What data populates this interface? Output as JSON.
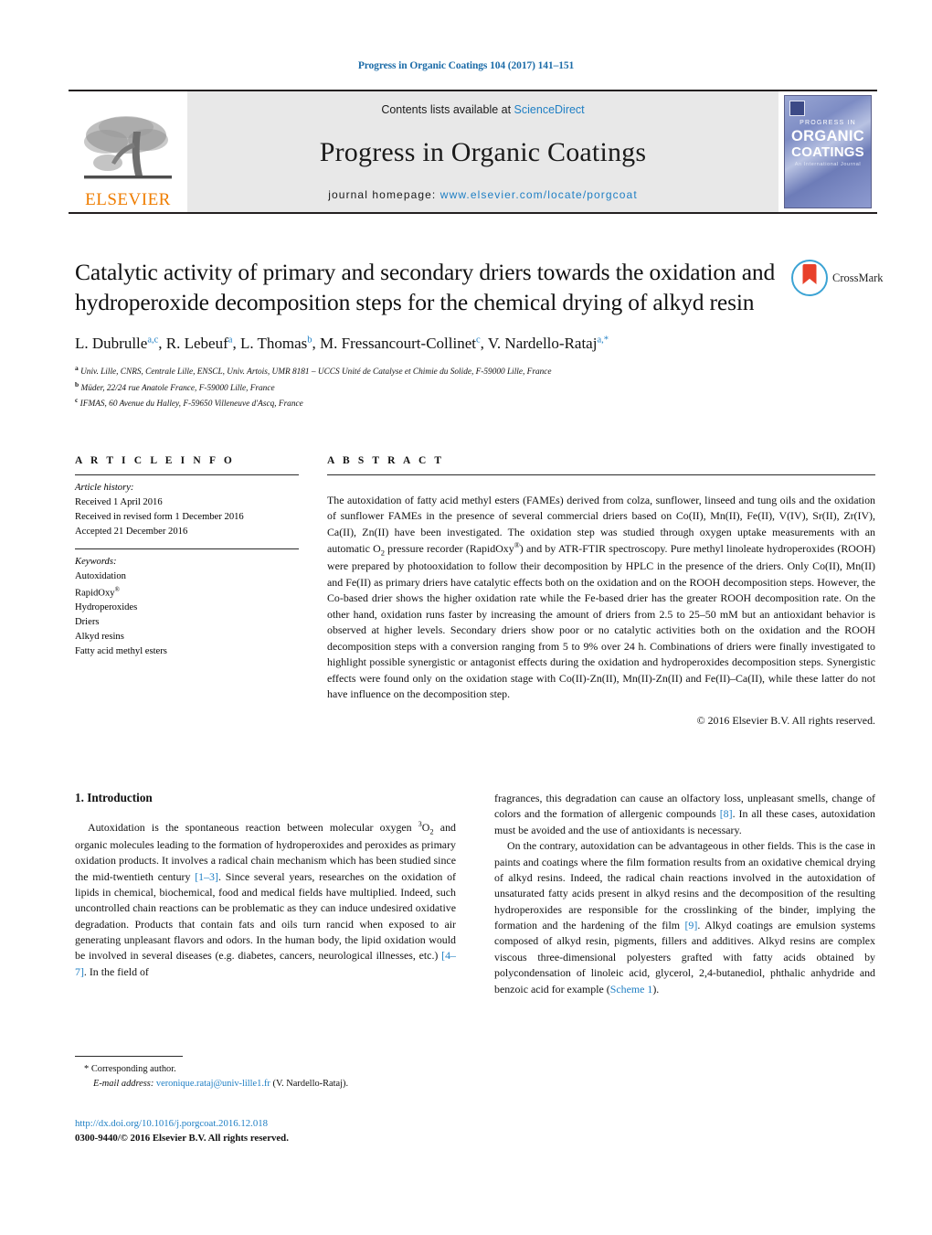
{
  "running_head": "Progress in Organic Coatings 104 (2017) 141–151",
  "masthead": {
    "publisher_name": "ELSEVIER",
    "contents_prefix": "Contents lists available at ",
    "contents_link": "ScienceDirect",
    "journal_title": "Progress in Organic Coatings",
    "homepage_prefix": "journal homepage: ",
    "homepage_url": "www.elsevier.com/locate/porgcoat",
    "cover": {
      "line1": "PROGRESS IN",
      "line2": "ORGANIC",
      "line3": "COATINGS",
      "line4": "An International Journal"
    }
  },
  "article": {
    "title": "Catalytic activity of primary and secondary driers towards the oxidation and hydroperoxide decomposition steps for the chemical drying of alkyd resin",
    "crossmark_label": "CrossMark",
    "authors": [
      {
        "name": "L. Dubrulle",
        "marks": "a,c"
      },
      {
        "name": "R. Lebeuf",
        "marks": "a"
      },
      {
        "name": "L. Thomas",
        "marks": "b"
      },
      {
        "name": "M. Fressancourt-Collinet",
        "marks": "c"
      },
      {
        "name": "V. Nardello-Rataj",
        "marks": "a,*"
      }
    ],
    "affiliations": [
      {
        "mark": "a",
        "text": "Univ. Lille, CNRS, Centrale Lille, ENSCL, Univ. Artois, UMR 8181 – UCCS Unité de Catalyse et Chimie du Solide, F-59000 Lille, France"
      },
      {
        "mark": "b",
        "text": "Müder, 22/24 rue Anatole France, F-59000 Lille, France"
      },
      {
        "mark": "c",
        "text": "IFMAS, 60 Avenue du Halley, F-59650 Villeneuve d'Ascq, France"
      }
    ]
  },
  "article_info": {
    "heading": "A R T I C L E   I N F O",
    "history_label": "Article history:",
    "history": [
      "Received 1 April 2016",
      "Received in revised form 1 December 2016",
      "Accepted 21 December 2016"
    ],
    "keywords_label": "Keywords:",
    "keywords": [
      "Autoxidation",
      "RapidOxy",
      "Hydroperoxides",
      "Driers",
      "Alkyd resins",
      "Fatty acid methyl esters"
    ],
    "rapidoxy_mark": "®"
  },
  "abstract": {
    "heading": "A B S T R A C T",
    "part1": "The autoxidation of fatty acid methyl esters (FAMEs) derived from colza, sunflower, linseed and tung oils and the oxidation of sunflower FAMEs in the presence of several commercial driers based on Co(II), Mn(II), Fe(II), V(IV), Sr(II), Zr(IV), Ca(II), Zn(II) have been investigated. The oxidation step was studied through oxygen uptake measurements with an automatic O",
    "sub_o2": "2",
    "part2": " pressure recorder (RapidOxy",
    "sup_reg": "®",
    "part3": ") and by ATR-FTIR spectroscopy. Pure methyl linoleate hydroperoxides (ROOH) were prepared by photooxidation to follow their decomposition by HPLC in the presence of the driers. Only Co(II), Mn(II) and Fe(II) as primary driers have catalytic effects both on the oxidation and on the ROOH decomposition steps. However, the Co-based drier shows the higher oxidation rate while the Fe-based drier has the greater ROOH decomposition rate. On the other hand, oxidation runs faster by increasing the amount of driers from 2.5 to 25–50 mM but an antioxidant behavior is observed at higher levels. Secondary driers show poor or no catalytic activities both on the oxidation and the ROOH decomposition steps with a conversion ranging from 5 to 9% over 24 h. Combinations of driers were finally investigated to highlight possible synergistic or antagonist effects during the oxidation and hydroperoxides decomposition steps. Synergistic effects were found only on the oxidation stage with Co(II)-Zn(II), Mn(II)-Zn(II) and Fe(II)–Ca(II), while these latter do not have influence on the decomposition step.",
    "copyright": "© 2016 Elsevier B.V. All rights reserved."
  },
  "introduction": {
    "heading": "1.  Introduction",
    "left_p1_a": "Autoxidation is the spontaneous reaction between molecular oxygen ",
    "left_p1_sup": "3",
    "left_p1_b": "O",
    "left_p1_sub": "2",
    "left_p1_c": " and organic molecules leading to the formation of hydroperoxides and peroxides as primary oxidation products. It involves a radical chain mechanism which has been studied since the mid-twentieth century ",
    "left_ref_1": "[1–3]",
    "left_p1_d": ". Since several years, researches on the oxidation of lipids in chemical, biochemical, food and medical fields have multiplied. Indeed, such uncontrolled chain reactions can be problematic as they can induce undesired oxidative degradation. Products that contain fats and oils turn rancid when exposed to air generating unpleasant flavors and odors. In the human body, the lipid oxidation would be involved in several diseases (e.g. diabetes, cancers, neurological illnesses, etc.) ",
    "left_ref_2": "[4–7]",
    "left_p1_e": ". In the field of",
    "right_p1_a": "fragrances, this degradation can cause an olfactory loss, unpleasant smells, change of colors and the formation of allergenic compounds ",
    "right_ref_1": "[8]",
    "right_p1_b": ". In all these cases, autoxidation must be avoided and the use of antioxidants is necessary.",
    "right_p2_a": "On the contrary, autoxidation can be advantageous in other fields. This is the case in paints and coatings where the film formation results from an oxidative chemical drying of alkyd resins. Indeed, the radical chain reactions involved in the autoxidation of unsaturated fatty acids present in alkyd resins and the decomposition of the resulting hydroperoxides are responsible for the crosslinking of the binder, implying the formation and the hardening of the film ",
    "right_ref_2": "[9]",
    "right_p2_b": ". Alkyd coatings are emulsion systems composed of alkyd resin, pigments, fillers and additives. Alkyd resins are complex viscous three-dimensional polyesters grafted with fatty acids obtained by polycondensation of linoleic acid, glycerol, 2,4-butanediol, phthalic anhydride and benzoic acid for example (",
    "right_scheme_link": "Scheme 1",
    "right_p2_c": ")."
  },
  "footer": {
    "corresponding_star": "*",
    "corresponding_label": "Corresponding author.",
    "email_label": "E-mail address:",
    "email": "veronique.rataj@univ-lille1.fr",
    "email_owner": "(V. Nardello-Rataj).",
    "doi_url": "http://dx.doi.org/10.1016/j.porgcoat.2016.12.018",
    "issn_line": "0300-9440/© 2016 Elsevier B.V. All rights reserved."
  },
  "colors": {
    "link_blue": "#1f7fc4",
    "elsevier_orange": "#ef7d00",
    "band_gray": "#e8e8e8",
    "crossmark_blue": "#3ba3d4",
    "crossmark_red": "#e8402a"
  }
}
